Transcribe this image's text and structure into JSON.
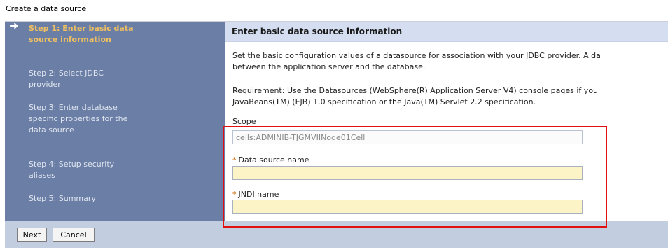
{
  "page": {
    "title": "Create a data source"
  },
  "steps": [
    {
      "label": "Step 1: Enter basic data source information",
      "current": true
    },
    {
      "label": "Step 2: Select JDBC provider",
      "current": false
    },
    {
      "label": "Step 3: Enter database specific properties for the data source",
      "current": false
    },
    {
      "label": "Step 4: Setup security aliases",
      "current": false
    },
    {
      "label": "Step 5: Summary",
      "current": false
    }
  ],
  "content": {
    "header": "Enter basic data source information",
    "desc_line1": "Set the basic configuration values of a datasource for association with your JDBC provider. A da",
    "desc_line2": "between the application server and the database.",
    "req_line1": "Requirement: Use the Datasources (WebSphere(R) Application Server V4) console pages if you",
    "req_line2": "JavaBeans(TM) (EJB) 1.0 specification or the Java(TM) Servlet 2.2 specification."
  },
  "form": {
    "scope_label": "Scope",
    "scope_value": "cells:ADMINIB-TJGMVIINode01Cell",
    "ds_name_label": "Data source name",
    "ds_name_value": "",
    "jndi_label": "JNDI name",
    "jndi_value": "",
    "required_marker": "*"
  },
  "buttons": {
    "next": "Next",
    "cancel": "Cancel"
  },
  "colors": {
    "nav_bg": "#6b7fa6",
    "current_step": "#f0c060",
    "header_bg": "#d4def0",
    "footer_bg": "#c3cde0",
    "required_field_bg": "#fcf3c7",
    "highlight_border": "#e01010"
  },
  "icons": {
    "current_step": "arrow-right-icon",
    "required": "asterisk-icon"
  }
}
